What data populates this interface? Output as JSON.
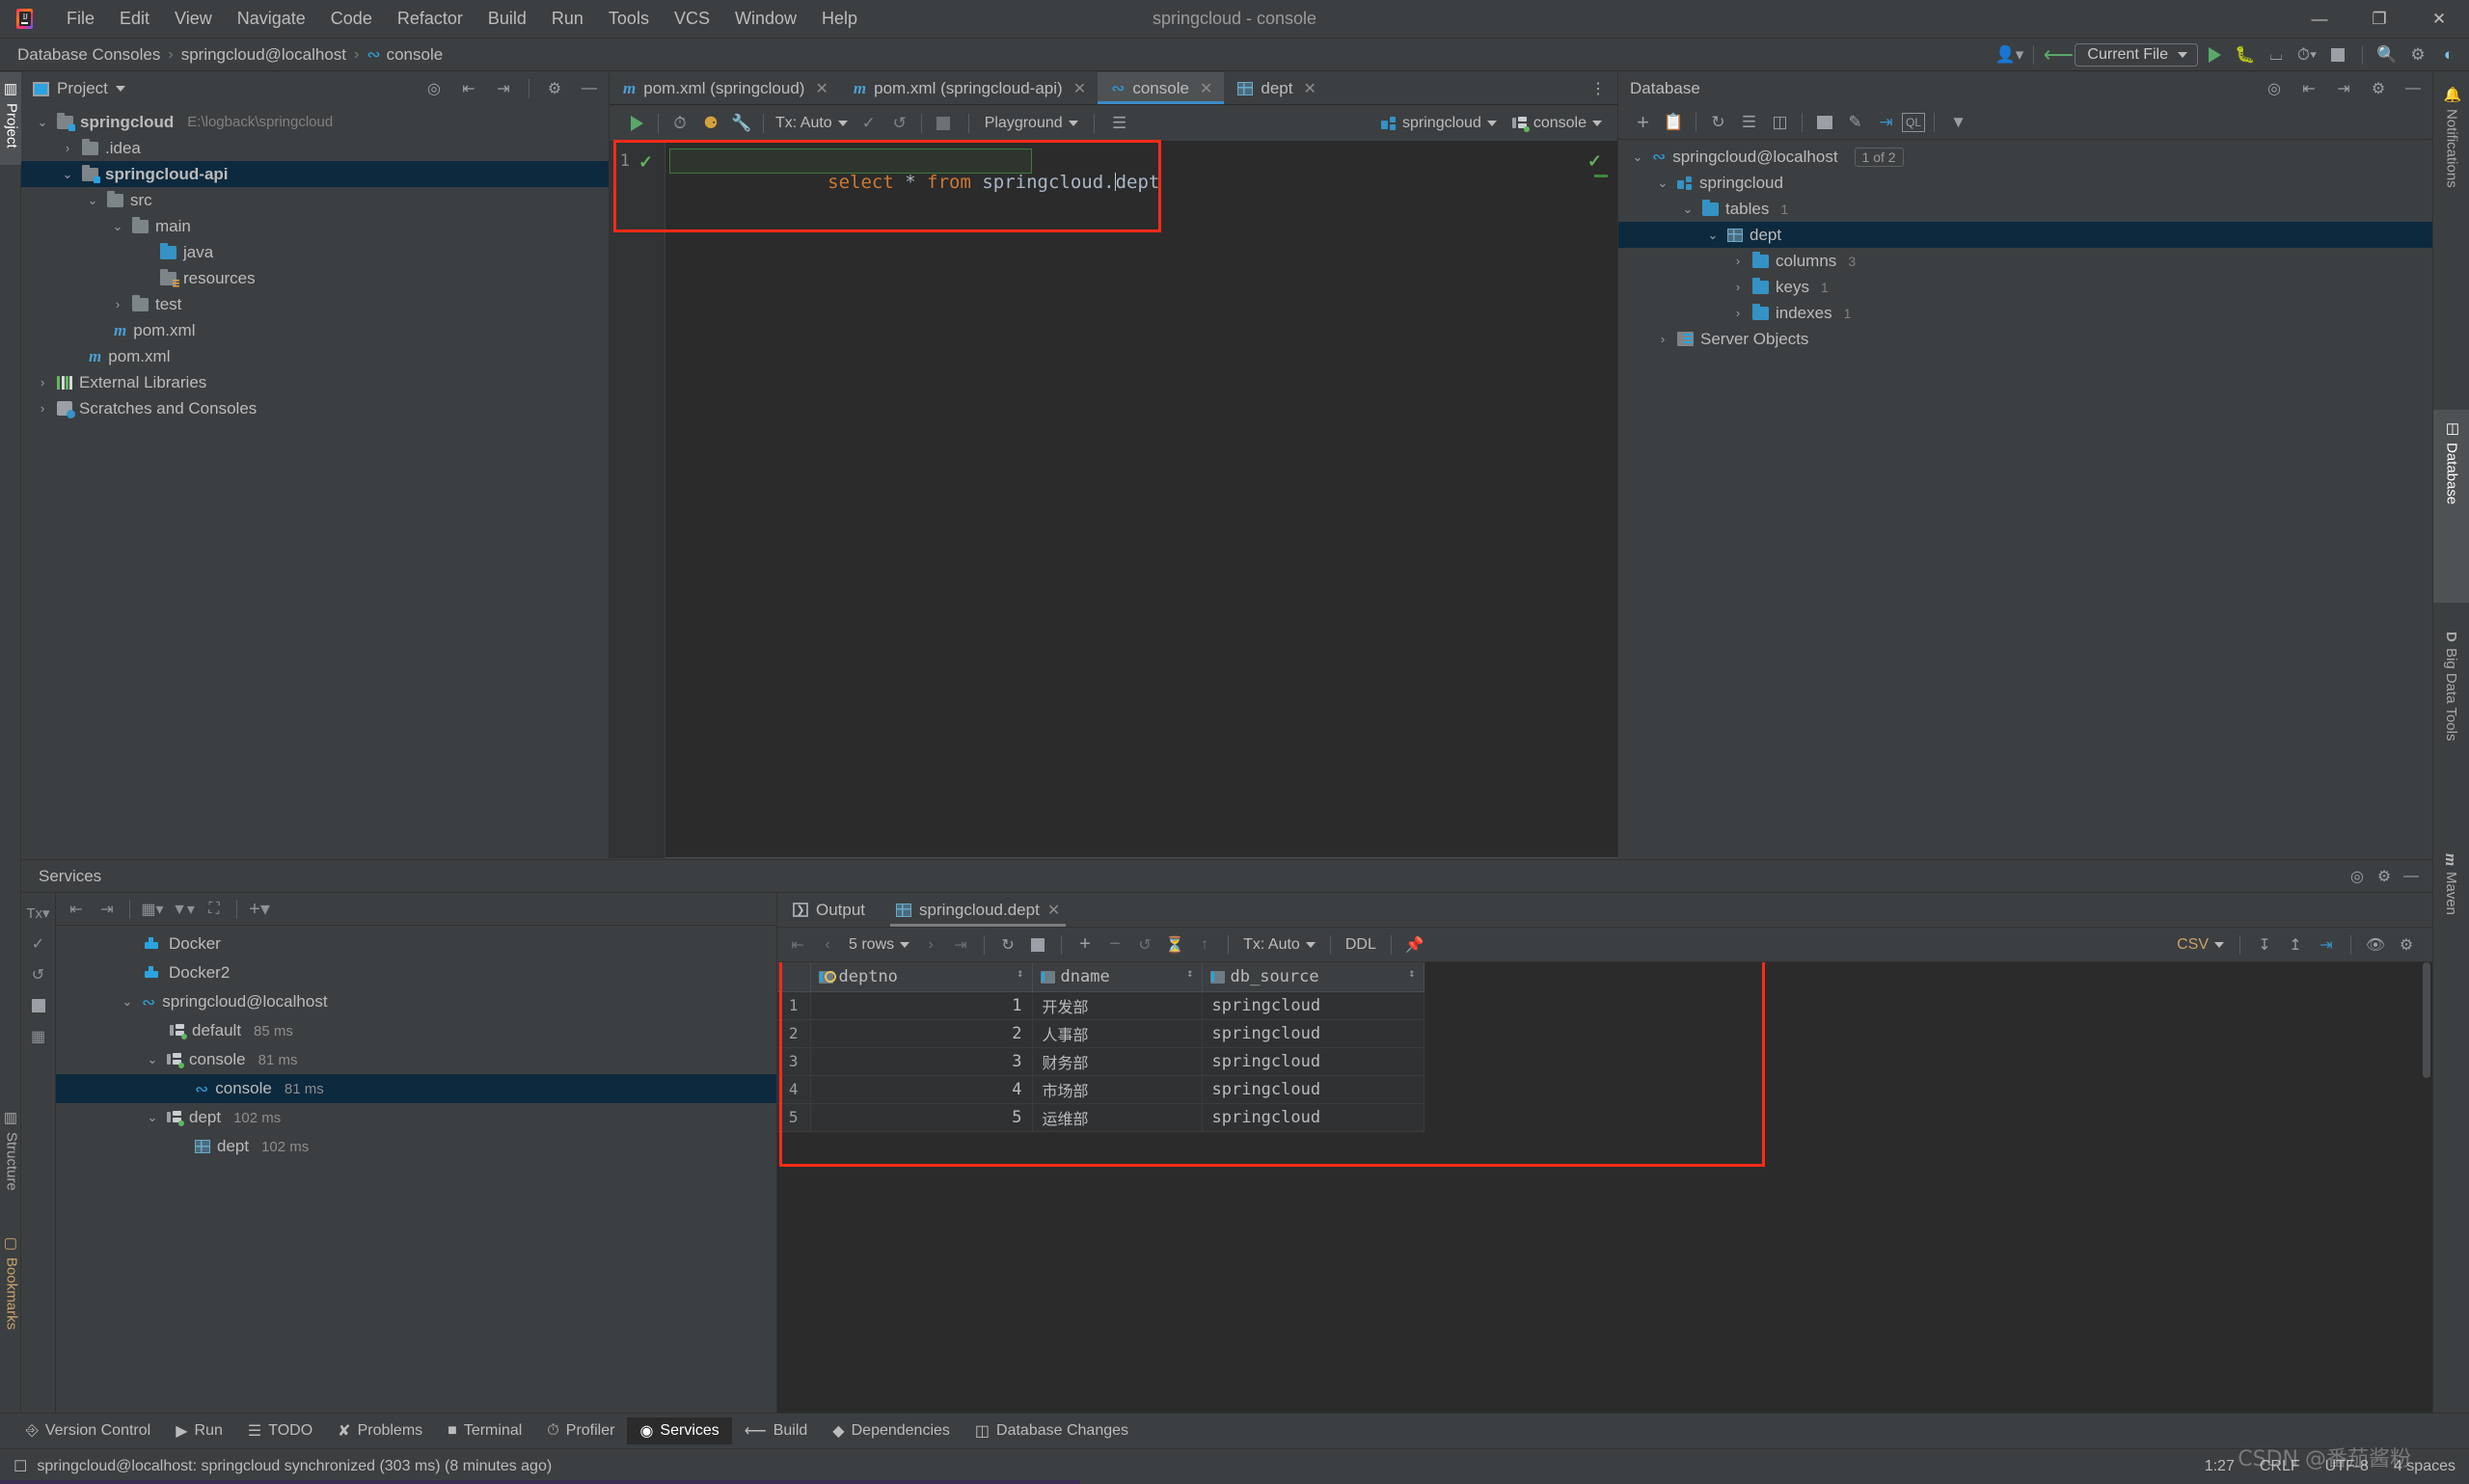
{
  "window": {
    "title": "springcloud - console",
    "minimize": "—",
    "restore": "❐",
    "close": "✕"
  },
  "menu": {
    "items": [
      "File",
      "Edit",
      "View",
      "Navigate",
      "Code",
      "Refactor",
      "Build",
      "Run",
      "Tools",
      "VCS",
      "Window",
      "Help"
    ]
  },
  "navbar": {
    "breadcrumbs": [
      "Database Consoles",
      "springcloud@localhost",
      "console"
    ],
    "run_config": "Current File",
    "icons": [
      "user-icon",
      "vcs-update-icon",
      "run-icon",
      "debug-icon",
      "run-coverage-icon",
      "profile-icon",
      "stop-icon",
      "search-everywhere-icon",
      "settings-icon"
    ]
  },
  "project_panel": {
    "title": "Project",
    "toolbar_icons": [
      "locate-icon",
      "expand-all-icon",
      "collapse-all-icon",
      "gear-icon",
      "hide-icon"
    ],
    "tree": [
      {
        "label": "springcloud",
        "path": "E:\\logback\\springcloud",
        "indent": 0,
        "chev": "⌄",
        "icon": "module-folder",
        "bold": true,
        "selected": false
      },
      {
        "label": ".idea",
        "path": "",
        "indent": 1,
        "chev": "›",
        "icon": "folder",
        "bold": false,
        "selected": false
      },
      {
        "label": "springcloud-api",
        "path": "",
        "indent": 1,
        "chev": "⌄",
        "icon": "module-folder",
        "bold": true,
        "selected": true
      },
      {
        "label": "src",
        "path": "",
        "indent": 2,
        "chev": "⌄",
        "icon": "folder",
        "bold": false,
        "selected": false
      },
      {
        "label": "main",
        "path": "",
        "indent": 3,
        "chev": "⌄",
        "icon": "folder",
        "bold": false,
        "selected": false
      },
      {
        "label": "java",
        "path": "",
        "indent": 4,
        "chev": "",
        "icon": "source-folder",
        "bold": false,
        "selected": false
      },
      {
        "label": "resources",
        "path": "",
        "indent": 4,
        "chev": "",
        "icon": "resource-folder",
        "bold": false,
        "selected": false
      },
      {
        "label": "test",
        "path": "",
        "indent": 3,
        "chev": "›",
        "icon": "folder",
        "bold": false,
        "selected": false
      },
      {
        "label": "pom.xml",
        "path": "",
        "indent": 3,
        "chev": "",
        "icon": "maven-file",
        "bold": false,
        "selected": false
      },
      {
        "label": "pom.xml",
        "path": "",
        "indent": 2,
        "chev": "",
        "icon": "maven-file",
        "bold": false,
        "selected": false
      },
      {
        "label": "External Libraries",
        "path": "",
        "indent": 1,
        "chev": "›",
        "icon": "libraries",
        "bold": false,
        "selected": false
      },
      {
        "label": "Scratches and Consoles",
        "path": "",
        "indent": 1,
        "chev": "›",
        "icon": "scratches",
        "bold": false,
        "selected": false
      }
    ]
  },
  "editor": {
    "tabs": [
      {
        "label": "pom.xml (springcloud)",
        "icon": "maven-file",
        "active": false,
        "closeable": true
      },
      {
        "label": "pom.xml (springcloud-api)",
        "icon": "maven-file",
        "active": false,
        "closeable": true
      },
      {
        "label": "console",
        "icon": "mysql-dolphin",
        "active": true,
        "closeable": true
      },
      {
        "label": "dept",
        "icon": "table-icon",
        "active": false,
        "closeable": true
      }
    ],
    "sql_toolbar": {
      "tx_label": "Tx: Auto",
      "schema_label": "Playground",
      "datasource_label": "springcloud",
      "session_label": "console",
      "icons": [
        "execute-icon",
        "history-icon",
        "explain-plan-icon",
        "db-tools-icon",
        "commit-icon",
        "rollback-icon",
        "stop-icon",
        "schema-switcher-icon"
      ]
    },
    "line_number": "1",
    "code": {
      "keyword1": "select",
      "star": " * ",
      "keyword2": "from",
      "identifier": " springcloud.",
      "identifier2": "dept"
    }
  },
  "database_panel": {
    "title": "Database",
    "toolbar_icons": [
      "add-icon",
      "copy-icon",
      "refresh-icon",
      "sync-settings-icon",
      "db-properties-icon",
      "table-editor-icon",
      "modify-icon",
      "jump-to-icon",
      "query-console-icon",
      "filter-icon"
    ],
    "tree": [
      {
        "label": "springcloud@localhost",
        "badge": "1 of 2",
        "count": "",
        "indent": 0,
        "chev": "⌄",
        "icon": "mysql-dolphin",
        "selected": false
      },
      {
        "label": "springcloud",
        "badge": "",
        "count": "",
        "indent": 1,
        "chev": "⌄",
        "icon": "schema-icon",
        "selected": false
      },
      {
        "label": "tables",
        "badge": "",
        "count": "1",
        "indent": 2,
        "chev": "⌄",
        "icon": "folder-blue",
        "selected": false
      },
      {
        "label": "dept",
        "badge": "",
        "count": "",
        "indent": 3,
        "chev": "⌄",
        "icon": "table-icon",
        "selected": true
      },
      {
        "label": "columns",
        "badge": "",
        "count": "3",
        "indent": 4,
        "chev": "›",
        "icon": "folder-blue",
        "selected": false
      },
      {
        "label": "keys",
        "badge": "",
        "count": "1",
        "indent": 4,
        "chev": "›",
        "icon": "folder-blue",
        "selected": false
      },
      {
        "label": "indexes",
        "badge": "",
        "count": "1",
        "indent": 4,
        "chev": "›",
        "icon": "folder-blue",
        "selected": false
      },
      {
        "label": "Server Objects",
        "badge": "",
        "count": "",
        "indent": 1,
        "chev": "›",
        "icon": "server-objects-icon",
        "selected": false
      }
    ]
  },
  "services": {
    "title": "Services",
    "toolbar_icons": [
      "tx-icon",
      "expand-all-icon",
      "collapse-all-icon",
      "group-icon",
      "filter-icon",
      "add-tab-icon",
      "add-icon"
    ],
    "side_icons": [
      "commit-icon",
      "rollback-icon",
      "stop-icon",
      "layout-icon"
    ],
    "tree": [
      {
        "label": "Docker",
        "time": "",
        "indent": 1,
        "chev": "",
        "icon": "docker-icon",
        "selected": false
      },
      {
        "label": "Docker2",
        "time": "",
        "indent": 1,
        "chev": "",
        "icon": "docker-icon",
        "selected": false
      },
      {
        "label": "springcloud@localhost",
        "time": "",
        "indent": 0,
        "chev": "⌄",
        "icon": "mysql-dolphin",
        "selected": false
      },
      {
        "label": "default",
        "time": "85 ms",
        "indent": 1,
        "chev": "",
        "icon": "connection-icon",
        "selected": false
      },
      {
        "label": "console",
        "time": "81 ms",
        "indent": 1,
        "chev": "⌄",
        "icon": "connection-icon",
        "selected": false
      },
      {
        "label": "console",
        "time": "81 ms",
        "indent": 2,
        "chev": "",
        "icon": "mysql-dolphin",
        "selected": true
      },
      {
        "label": "dept",
        "time": "102 ms",
        "indent": 1,
        "chev": "⌄",
        "icon": "connection-icon",
        "selected": false
      },
      {
        "label": "dept",
        "time": "102 ms",
        "indent": 2,
        "chev": "",
        "icon": "table-icon",
        "selected": false
      }
    ]
  },
  "result": {
    "tabs": [
      {
        "label": "Output",
        "icon": "output-icon",
        "active": false,
        "closeable": false
      },
      {
        "label": "springcloud.dept",
        "icon": "table-icon",
        "active": true,
        "closeable": true
      }
    ],
    "toolbar": {
      "rows_label": "5 rows",
      "tx_label": "Tx: Auto",
      "ddl_label": "DDL",
      "format_label": "CSV",
      "icons": [
        "first-page-icon",
        "prev-page-icon",
        "next-page-icon",
        "last-page-icon",
        "reload-icon",
        "stop-icon",
        "add-row-icon",
        "delete-row-icon",
        "revert-icon",
        "revert-selected-icon",
        "submit-icon",
        "pin-icon",
        "export-icon",
        "import-icon",
        "jump-to-icon",
        "view-options-icon",
        "settings-icon"
      ]
    },
    "grid": {
      "columns": [
        {
          "name": "deptno",
          "icon": "primary-key-column-icon"
        },
        {
          "name": "dname",
          "icon": "column-icon"
        },
        {
          "name": "db_source",
          "icon": "column-icon"
        }
      ],
      "rows": [
        {
          "n": "1",
          "deptno": "1",
          "dname": "开发部",
          "db_source": "springcloud"
        },
        {
          "n": "2",
          "deptno": "2",
          "dname": "人事部",
          "db_source": "springcloud"
        },
        {
          "n": "3",
          "deptno": "3",
          "dname": "财务部",
          "db_source": "springcloud"
        },
        {
          "n": "4",
          "deptno": "4",
          "dname": "市场部",
          "db_source": "springcloud"
        },
        {
          "n": "5",
          "deptno": "5",
          "dname": "运维部",
          "db_source": "springcloud"
        }
      ]
    }
  },
  "left_stripe": {
    "items": [
      {
        "label": "Project",
        "icon": "project-icon",
        "active": true
      },
      {
        "label": "Structure",
        "icon": "structure-icon",
        "active": false
      },
      {
        "label": "Bookmarks",
        "icon": "bookmarks-icon",
        "active": false
      }
    ]
  },
  "right_stripe": {
    "items": [
      {
        "label": "Notifications",
        "icon": "bell-icon",
        "active": false
      },
      {
        "label": "Database",
        "icon": "database-icon",
        "active": true
      },
      {
        "label": "Big Data Tools",
        "icon": "big-data-icon",
        "active": false
      },
      {
        "label": "Maven",
        "icon": "maven-icon",
        "active": false
      }
    ]
  },
  "tool_window_bar": {
    "items": [
      {
        "label": "Version Control",
        "icon": "branch-icon",
        "active": false
      },
      {
        "label": "Run",
        "icon": "run-icon",
        "active": false
      },
      {
        "label": "TODO",
        "icon": "todo-icon",
        "active": false
      },
      {
        "label": "Problems",
        "icon": "problems-icon",
        "active": false
      },
      {
        "label": "Terminal",
        "icon": "terminal-icon",
        "active": false
      },
      {
        "label": "Profiler",
        "icon": "profiler-icon",
        "active": false
      },
      {
        "label": "Services",
        "icon": "services-icon",
        "active": true
      },
      {
        "label": "Build",
        "icon": "build-icon",
        "active": false
      },
      {
        "label": "Dependencies",
        "icon": "dependencies-icon",
        "active": false
      },
      {
        "label": "Database Changes",
        "icon": "database-changes-icon",
        "active": false
      }
    ]
  },
  "statusbar": {
    "message": "springcloud@localhost: springcloud synchronized (303 ms) (8 minutes ago)",
    "caret": "1:27",
    "line_sep": "CRLF",
    "encoding": "UTF-8",
    "indent": "4 spaces",
    "watermark": "CSDN @番茄酱粉"
  },
  "colors": {
    "accent_blue": "#3c8ac9",
    "selection": "#0d293e",
    "panel_bg": "#3c3f41",
    "editor_bg": "#2b2b2b",
    "highlight_red": "#ff2a18",
    "green": "#59a869",
    "keyword_orange": "#cc7832"
  }
}
